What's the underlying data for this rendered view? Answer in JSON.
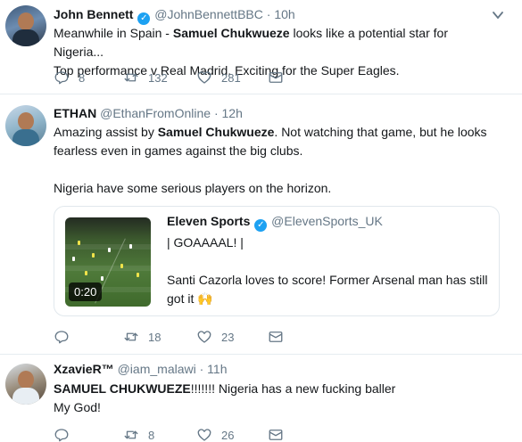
{
  "tweets": [
    {
      "name": "John Bennett",
      "handle": "@JohnBennettBBC",
      "sep": "·",
      "time": "10h",
      "text_1a": "Meanwhile in Spain - ",
      "text_1b": "Samuel Chukwueze",
      "text_1c": " looks like a potential star for Nigeria...",
      "text_2": "Top performance v Real Madrid. Exciting for the Super Eagles.",
      "replies": "8",
      "retweets": "132",
      "likes": "281"
    },
    {
      "name": "ETHAN",
      "handle": "@EthanFromOnline",
      "sep": "·",
      "time": "12h",
      "text_1a": "Amazing assist by ",
      "text_1b": "Samuel Chukwueze",
      "text_1c": ". Not watching that game, but he looks",
      "text_2": "fearless even in games against the big clubs.",
      "text_3": "Nigeria have some serious players on the horizon.",
      "replies": "",
      "retweets": "18",
      "likes": "23",
      "quote": {
        "name": "Eleven Sports",
        "handle": "@ElevenSports_UK",
        "line_1": "| GOAAAAL! |",
        "line_2": "Santi Cazorla loves to score! Former Arsenal man has still",
        "line_3": "got it 🙌",
        "video_duration": "0:20"
      }
    },
    {
      "name": "XzavieR™",
      "handle": "@iam_malawi",
      "sep": "·",
      "time": "11h",
      "text_1a": "SAMUEL CHUKWUEZE",
      "text_1b": "!!!!!!! Nigeria has a new fucking baller",
      "text_2": "My God!",
      "replies": "",
      "retweets": "8",
      "likes": "26"
    }
  ],
  "icons": {
    "verified": "verified-badge",
    "reply": "reply-icon",
    "retweet": "retweet-icon",
    "like": "heart-icon",
    "dm": "envelope-icon",
    "caret": "chevron-down-icon"
  },
  "colors": {
    "text": "#14171a",
    "secondary": "#657786",
    "verified": "#1da1f2",
    "border": "#e6ecf0"
  }
}
